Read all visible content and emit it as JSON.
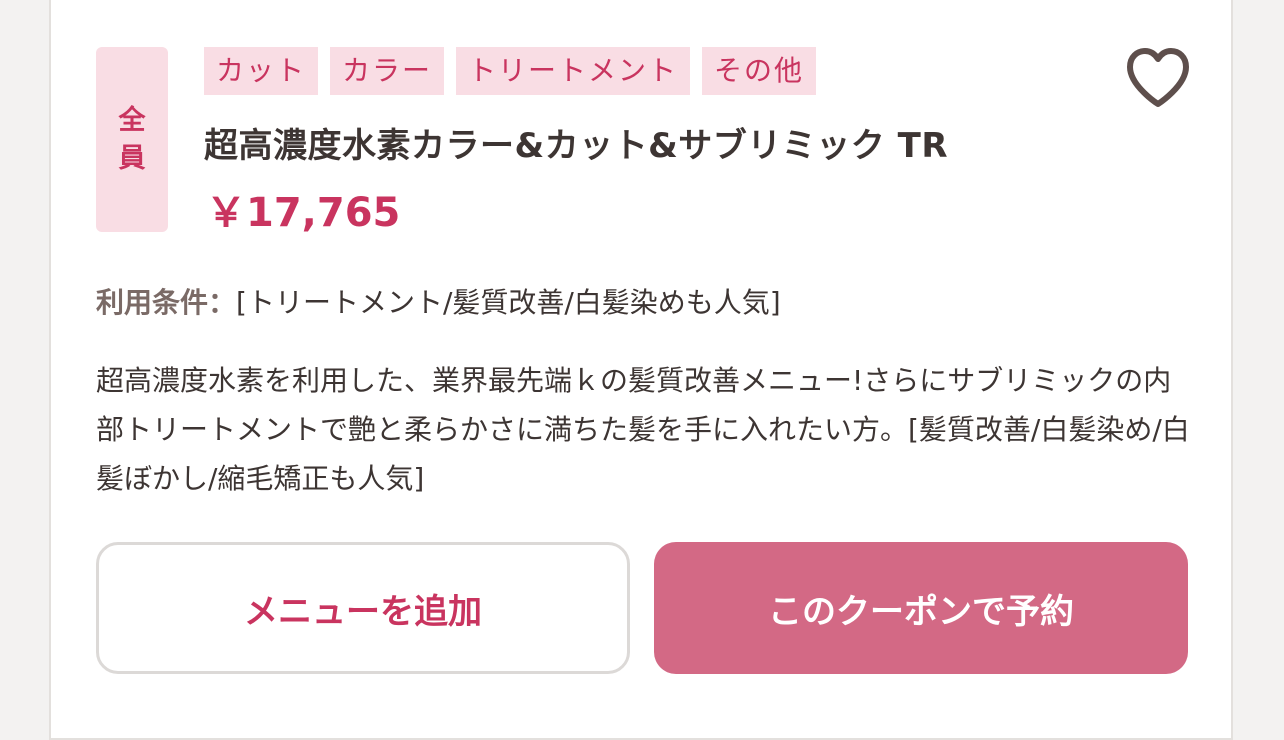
{
  "coupon": {
    "target": [
      "全",
      "員"
    ],
    "tags": [
      "カット",
      "カラー",
      "トリートメント",
      "その他"
    ],
    "title": "超高濃度水素カラー&カット&サブリミック TR",
    "price": "￥17,765",
    "conditions_label": "利用条件：",
    "conditions_value": "[トリートメント/髪質改善/白髪染めも人気]",
    "description": "超高濃度水素を利用した、業界最先端ｋの髪質改善メニュー!さらにサブリミックの内部トリートメントで艶と柔らかさに満ちた髪を手に入れたい方。[髪質改善/白髪染め/白髪ぼかし/縮毛矯正も人気]",
    "favorite_icon": "heart-outline-icon"
  },
  "actions": {
    "add_menu_label": "メニューを追加",
    "reserve_label": "このクーポンで予約"
  },
  "colors": {
    "accent": "#c9345f",
    "badge_bg": "#f9dde4",
    "reserve_bg": "#d36985",
    "heart": "#5e4f4c"
  }
}
